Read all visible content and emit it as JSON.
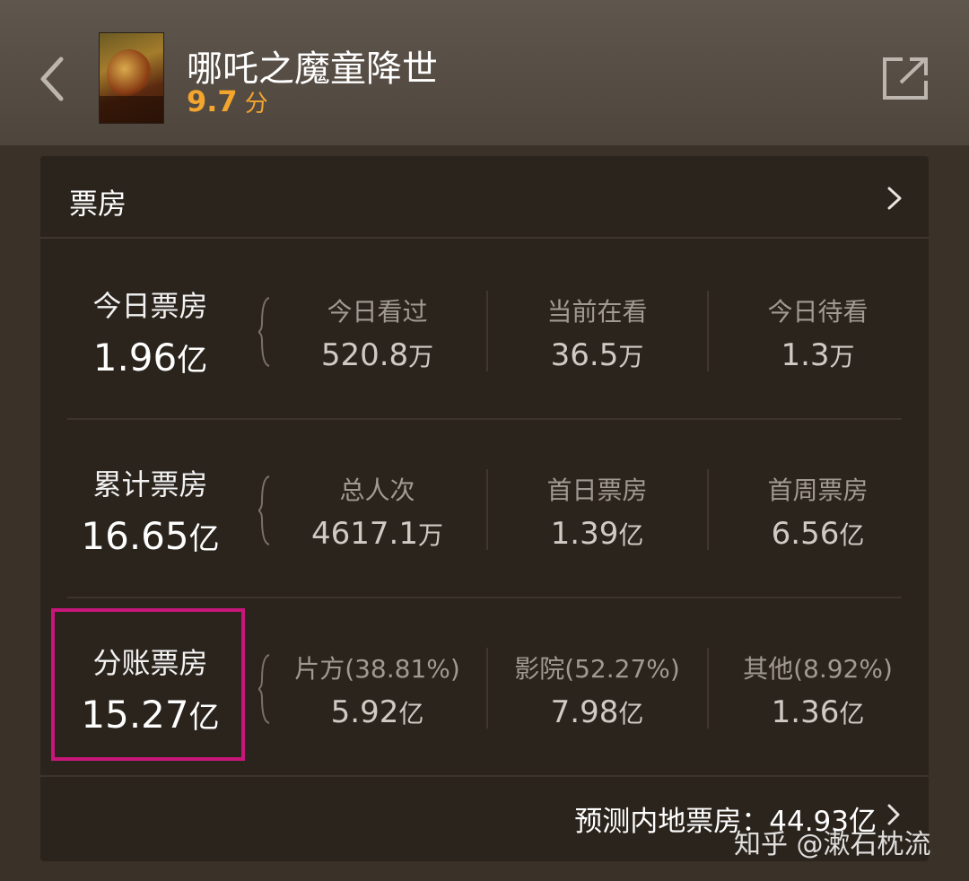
{
  "header": {
    "title": "哪吒之魔童降世",
    "rating_value": "9.7",
    "rating_unit": "分"
  },
  "card": {
    "title": "票房",
    "rows": [
      {
        "main": {
          "label": "今日票房",
          "value": "1.96",
          "unit": "亿"
        },
        "subs": [
          {
            "label": "今日看过",
            "value": "520.8",
            "unit": "万"
          },
          {
            "label": "当前在看",
            "value": "36.5",
            "unit": "万"
          },
          {
            "label": "今日待看",
            "value": "1.3",
            "unit": "万"
          }
        ]
      },
      {
        "main": {
          "label": "累计票房",
          "value": "16.65",
          "unit": "亿"
        },
        "subs": [
          {
            "label": "总人次",
            "value": "4617.1",
            "unit": "万"
          },
          {
            "label": "首日票房",
            "value": "1.39",
            "unit": "亿"
          },
          {
            "label": "首周票房",
            "value": "6.56",
            "unit": "亿"
          }
        ]
      },
      {
        "main": {
          "label": "分账票房",
          "value": "15.27",
          "unit": "亿"
        },
        "subs": [
          {
            "label": "片方(38.81%)",
            "value": "5.92",
            "unit": "亿"
          },
          {
            "label": "影院(52.27%)",
            "value": "7.98",
            "unit": "亿"
          },
          {
            "label": "其他(8.92%)",
            "value": "1.36",
            "unit": "亿"
          }
        ]
      }
    ],
    "forecast": "预测内地票房：44.93亿"
  },
  "watermark": "知乎 @漱石枕流",
  "colors": {
    "rating": "#f3a52e",
    "highlight_border": "#c8177a",
    "card_bg": "#2b241d",
    "page_bg": "#3a3128"
  },
  "icons": {
    "back": "chevron-left-icon",
    "share": "share-external-icon",
    "card_arrow": "chevron-right-icon",
    "forecast_arrow": "chevron-right-icon"
  }
}
